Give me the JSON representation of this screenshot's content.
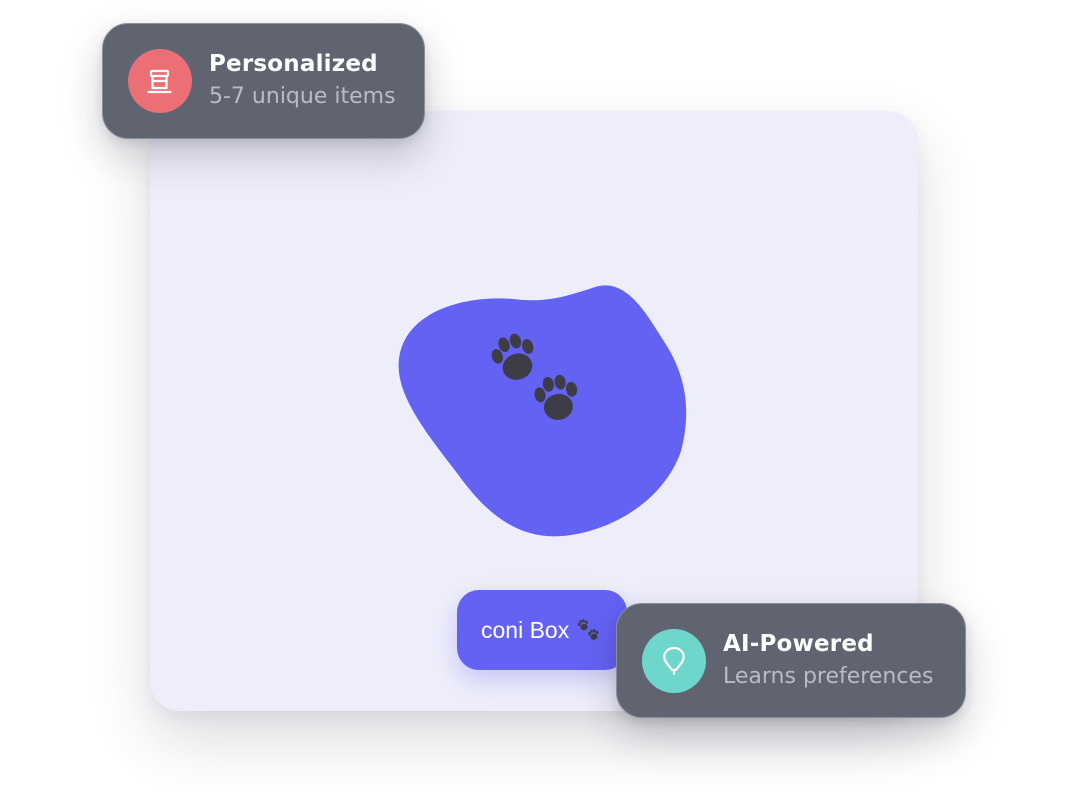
{
  "colors": {
    "card_background": "#eeeefb",
    "blob": "#6462f3",
    "badge_background": "#5f6470",
    "badge_subtext": "#b8bcc6",
    "personalized_icon_bg": "#ec6f76",
    "ai_icon_bg": "#6fd6cc",
    "paw": "#3d3d48"
  },
  "badges": {
    "personalized": {
      "title": "Personalized",
      "subtitle": "5-7 unique items",
      "icon": "gift-box-icon"
    },
    "ai": {
      "title": "AI-Powered",
      "subtitle": "Learns preferences",
      "icon": "lightbulb-icon"
    }
  },
  "hero": {
    "illustration_icon": "paw-prints-icon"
  },
  "box_button": {
    "label": "coni Box",
    "icon": "paw-prints-icon"
  }
}
